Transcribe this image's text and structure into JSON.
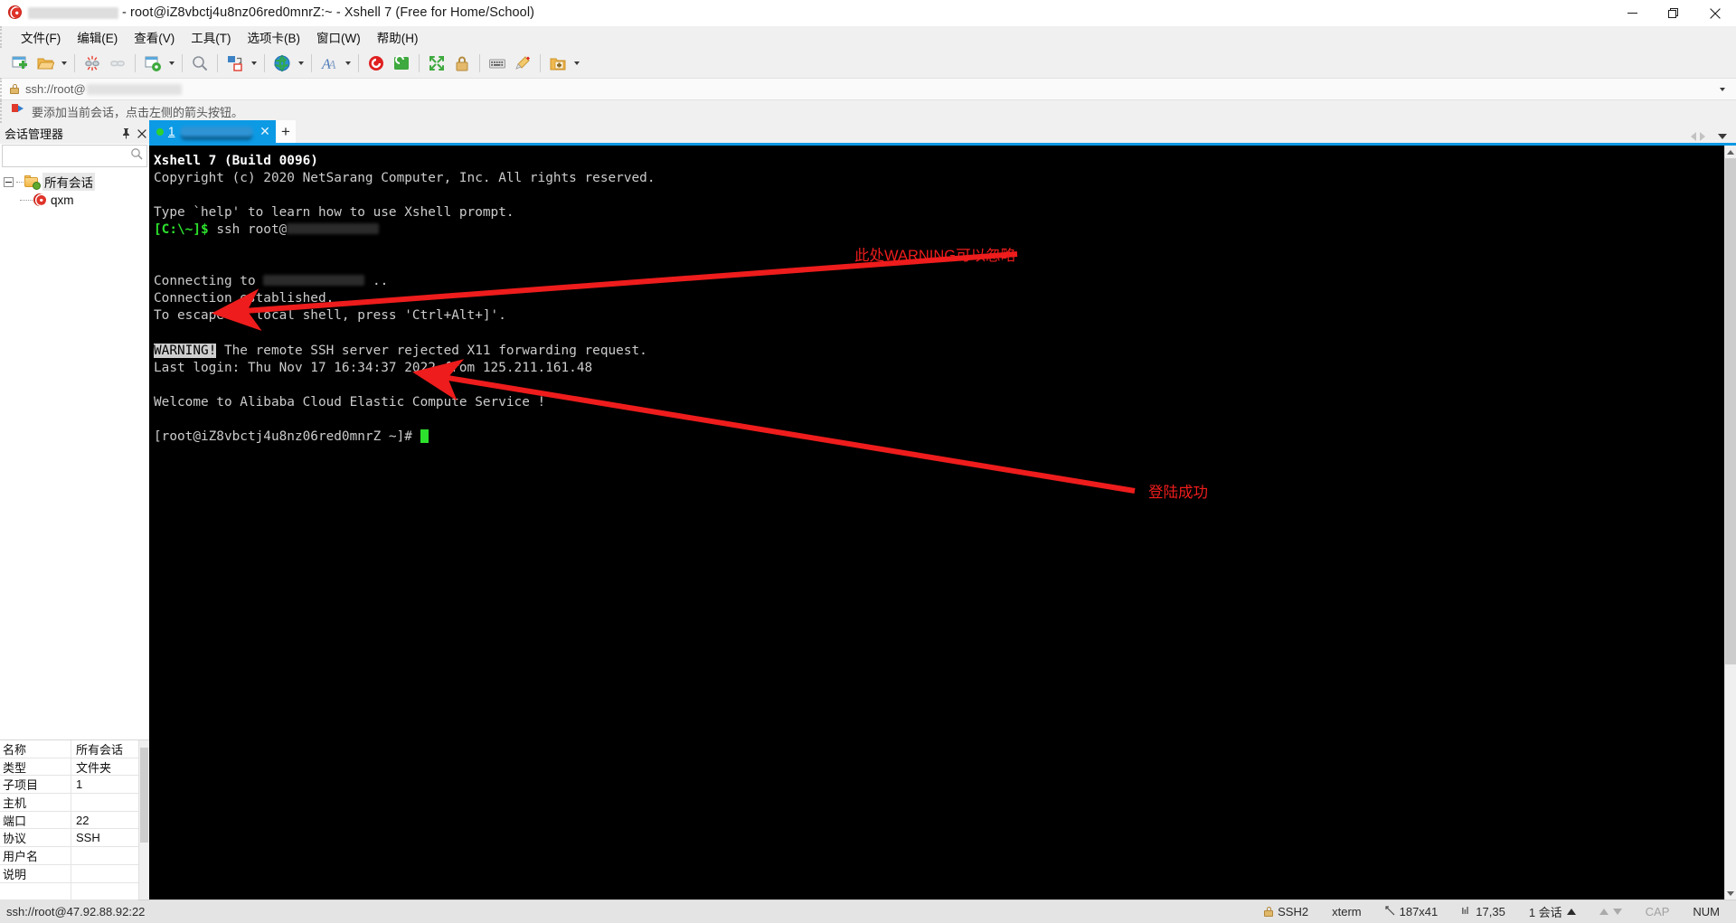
{
  "window": {
    "title": " - root@iZ8vbctj4u8nz06red0mnrZ:~ - Xshell 7 (Free for Home/School)",
    "app_icon": "xshell-swirl-icon",
    "minimize": "—",
    "maximize": "❐",
    "close": "✕"
  },
  "menu": {
    "items": [
      {
        "label": "文件(F)",
        "name": "menu-file"
      },
      {
        "label": "编辑(E)",
        "name": "menu-edit"
      },
      {
        "label": "查看(V)",
        "name": "menu-view"
      },
      {
        "label": "工具(T)",
        "name": "menu-tools"
      },
      {
        "label": "选项卡(B)",
        "name": "menu-tabs"
      },
      {
        "label": "窗口(W)",
        "name": "menu-window"
      },
      {
        "label": "帮助(H)",
        "name": "menu-help"
      }
    ]
  },
  "toolbar": {
    "icons": [
      "new-session-icon",
      "open-folder-icon",
      "disconnect-icon",
      "reconnect-icon",
      "session-properties-icon",
      "find-icon",
      "transfer-file-icon",
      "globe-encoding-icon",
      "font-icon",
      "xshell-icon",
      "xftp-icon",
      "fullscreen-icon",
      "lock-icon",
      "keyboard-icon",
      "highlight-icon",
      "add-to-folder-icon"
    ]
  },
  "address_bar": {
    "icon": "lock-icon",
    "value": "ssh://root@",
    "redacted": true,
    "dropdown": "chevron-down-icon"
  },
  "hint_bar": {
    "icon": "red-arrow-flag-icon",
    "text": "要添加当前会话，点击左侧的箭头按钮。"
  },
  "session_manager": {
    "title": "会话管理器",
    "pin": "pin-icon",
    "close": "✕",
    "search_placeholder": "",
    "search_icon": "search-icon",
    "tree": {
      "root": {
        "label": "所有会话",
        "icon": "folder-sessions-icon",
        "expanded": true
      },
      "children": [
        {
          "label": "qxm",
          "icon": "xshell-session-icon"
        }
      ]
    }
  },
  "properties": {
    "rows": [
      {
        "key": "名称",
        "value": "所有会话"
      },
      {
        "key": "类型",
        "value": "文件夹"
      },
      {
        "key": "子项目",
        "value": "1"
      },
      {
        "key": "主机",
        "value": ""
      },
      {
        "key": "端口",
        "value": "22"
      },
      {
        "key": "协议",
        "value": "SSH"
      },
      {
        "key": "用户名",
        "value": ""
      },
      {
        "key": "说明",
        "value": ""
      },
      {
        "key": "",
        "value": ""
      }
    ]
  },
  "tabs": {
    "active": {
      "number": "1",
      "status_dot": "green",
      "label_redacted": true,
      "close": "✕"
    },
    "new_tab": "+",
    "nav": {
      "prev": "prev-tab-icon",
      "next": "next-tab-icon",
      "list": "tab-list-icon"
    }
  },
  "terminal": {
    "lines": [
      {
        "segs": [
          {
            "t": "Xshell 7 (Build 0096)",
            "c": "bold"
          }
        ]
      },
      {
        "segs": [
          {
            "t": "Copyright (c) 2020 NetSarang Computer, Inc. All rights reserved.",
            "c": ""
          }
        ]
      },
      {
        "segs": [
          {
            "t": "",
            "c": ""
          }
        ]
      },
      {
        "segs": [
          {
            "t": "Type `help' to learn how to use Xshell prompt.",
            "c": ""
          }
        ]
      },
      {
        "segs": [
          {
            "t": "[C:\\~]$",
            "c": "green"
          },
          {
            "t": " ssh root@",
            "c": ""
          },
          {
            "t": "",
            "c": "redact"
          }
        ]
      },
      {
        "segs": [
          {
            "t": "",
            "c": ""
          }
        ]
      },
      {
        "segs": [
          {
            "t": "",
            "c": ""
          }
        ]
      },
      {
        "segs": [
          {
            "t": "Connecting to ",
            "c": ""
          },
          {
            "t": "",
            "c": "redact2"
          },
          {
            "t": " ..",
            "c": ""
          }
        ]
      },
      {
        "segs": [
          {
            "t": "Connection established.",
            "c": ""
          }
        ]
      },
      {
        "segs": [
          {
            "t": "To escape to local shell, press 'Ctrl+Alt+]'.",
            "c": ""
          }
        ]
      },
      {
        "segs": [
          {
            "t": "",
            "c": ""
          }
        ]
      },
      {
        "segs": [
          {
            "t": "WARNING!",
            "c": "inv"
          },
          {
            "t": " The remote SSH server rejected X11 forwarding request.",
            "c": ""
          }
        ]
      },
      {
        "segs": [
          {
            "t": "Last login: Thu Nov 17 16:34:37 2022 from 125.211.161.48",
            "c": ""
          }
        ]
      },
      {
        "segs": [
          {
            "t": "",
            "c": ""
          }
        ]
      },
      {
        "segs": [
          {
            "t": "Welcome to Alibaba Cloud Elastic Compute Service !",
            "c": ""
          }
        ]
      },
      {
        "segs": [
          {
            "t": "",
            "c": ""
          }
        ]
      },
      {
        "segs": [
          {
            "t": "[root@iZ8vbctj4u8nz06red0mnrZ ~]# ",
            "c": ""
          },
          {
            "t": "",
            "c": "cursor"
          }
        ]
      }
    ]
  },
  "annotations": [
    {
      "name": "annotation-warning-ignorable",
      "text": "此处WARNING可以忽略",
      "color": "#ee1c1c"
    },
    {
      "name": "annotation-login-success",
      "text": "登陆成功",
      "color": "#ee1c1c"
    }
  ],
  "status_bar": {
    "left": "ssh://root@47.92.88.92:22",
    "protocol": "SSH2",
    "terminal_type": "xterm",
    "size": "187x41",
    "cursor_pos": "17,35",
    "sessions": "1 会话",
    "cap": "CAP",
    "num": "NUM"
  }
}
